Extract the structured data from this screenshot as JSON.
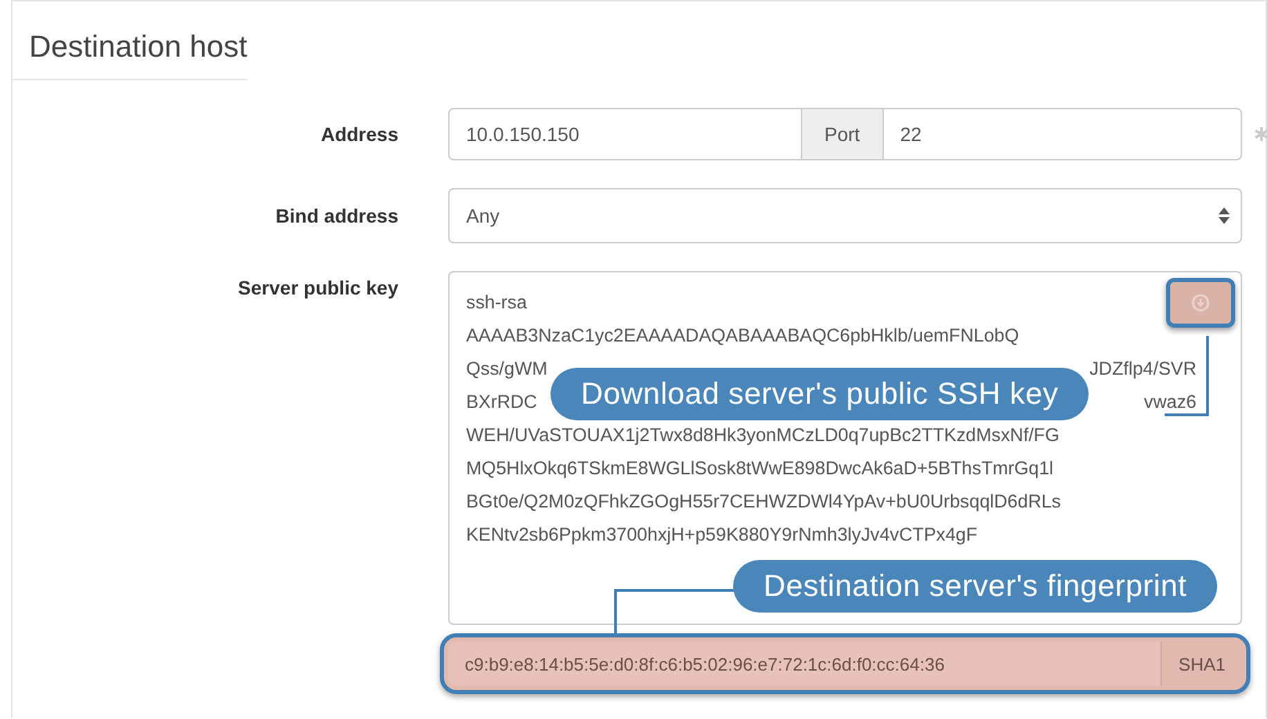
{
  "section": {
    "title": "Destination host"
  },
  "address": {
    "label": "Address",
    "value": "10.0.150.150",
    "port_label": "Port",
    "port_value": "22"
  },
  "bind_address": {
    "label": "Bind address",
    "value": "Any"
  },
  "server_key": {
    "label": "Server public key",
    "lines": [
      {
        "left": "ssh-rsa"
      },
      {
        "left": "AAAAB3NzaC1yc2EAAAADAQABAAABAQC6pbHklb/uemFNLobQ"
      },
      {
        "left": "Qss/gWM",
        "right": "JDZflp4/SVR"
      },
      {
        "left": "BXrRDC",
        "right": "vwaz6"
      },
      {
        "left": "WEH/UVaSTOUAX1j2Twx8d8Hk3yonMCzLD0q7upBc2TTKzdMsxNf/FG"
      },
      {
        "left": "MQ5HlxOkq6TSkmE8WGLlSosk8tWwE898DwcAk6aD+5BThsTmrGq1l"
      },
      {
        "left": "BGt0e/Q2M0zQFhkZGOgH55r7CEHWZDWl4YpAv+bU0UrbsqqlD6dRLs"
      },
      {
        "left": "KENtv2sb6Ppkm3700hxjH+p59K880Y9rNmh3lyJv4vCTPx4gF"
      }
    ],
    "fingerprint": "c9:b9:e8:14:b5:5e:d0:8f:c6:b5:02:96:e7:72:1c:6d:f0:cc:64:36",
    "hash": "SHA1"
  },
  "callouts": [
    {
      "kind": "download",
      "text": "Download server's public SSH key"
    },
    {
      "kind": "fingerprint",
      "text": "Destination server's fingerprint"
    }
  ]
}
